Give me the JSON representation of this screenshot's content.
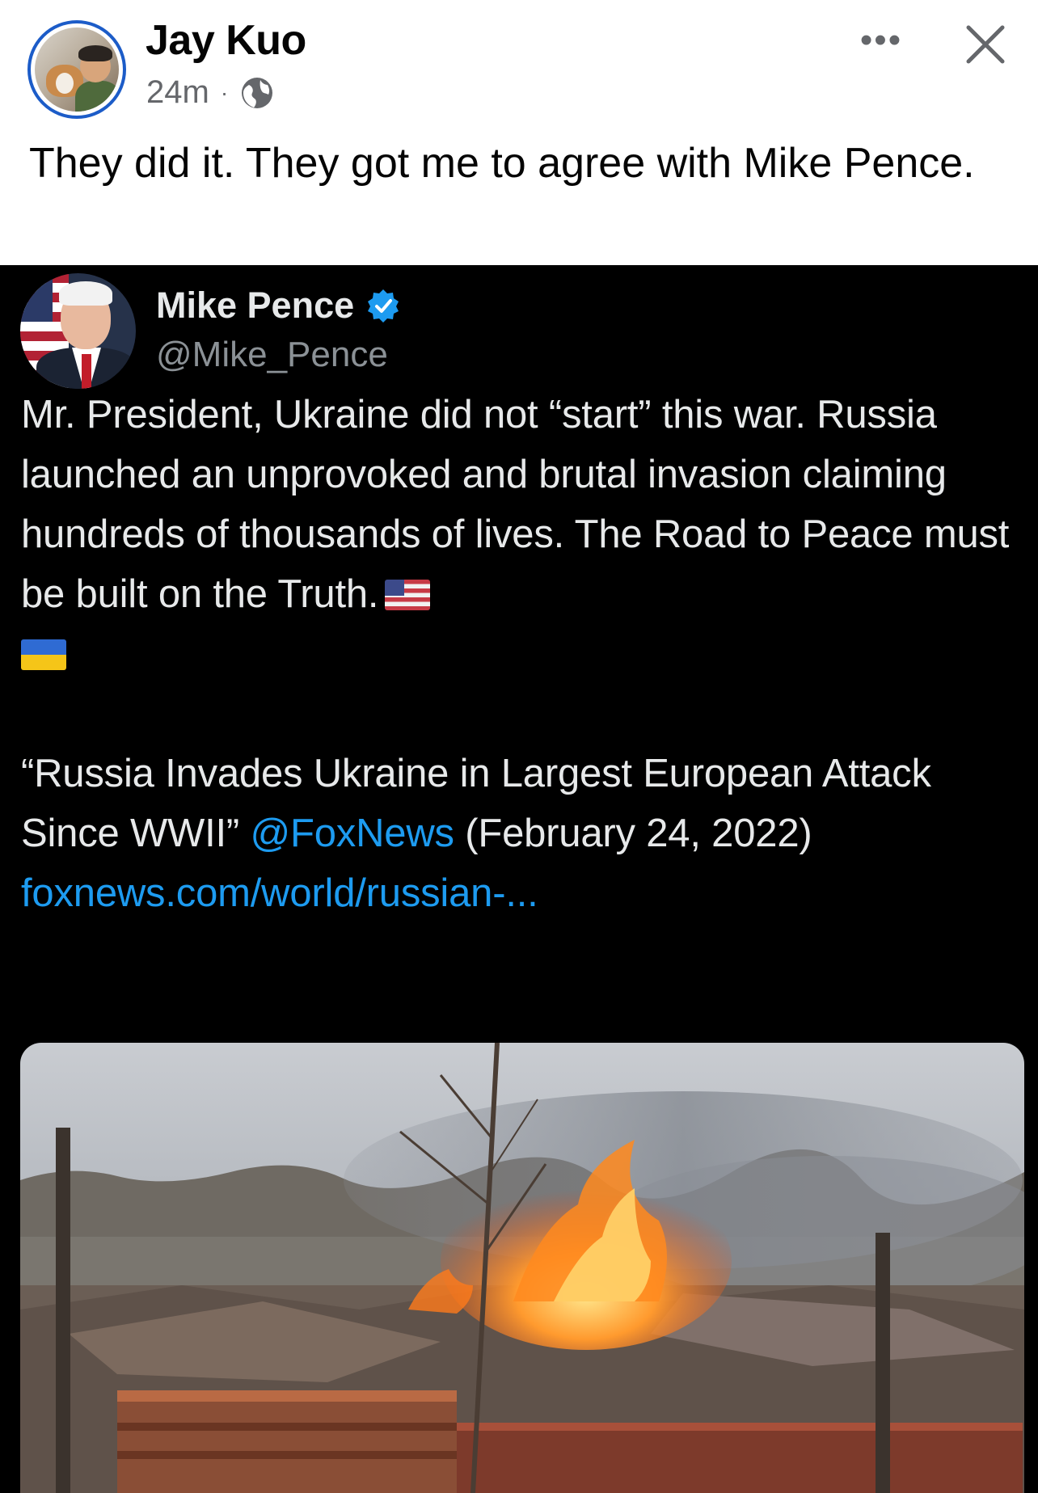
{
  "post": {
    "author": "Jay Kuo",
    "time": "24m",
    "separator": "·",
    "audience_icon": "globe-icon",
    "more_label": "•••",
    "text": "They did it. They got me to agree with Mike Pence."
  },
  "tweet": {
    "name": "Mike Pence",
    "handle": "@Mike_Pence",
    "verified_icon": "verified-badge-icon",
    "line1": "Mr. President, Ukraine did not “start” this war. Russia launched an unprovoked and brutal invasion claiming hundreds of thousands of lives. The Road to Peace must be built on the Truth.",
    "headline": "“Russia Invades Ukraine in Largest European Attack Since WWII”",
    "mention": "@FoxNews",
    "date": "(February 24, 2022)",
    "url": "foxnews.com/world/russian-...",
    "media_description": "burning-building-photo"
  },
  "colors": {
    "fb_avatar_ring": "#1c5cc8",
    "fb_text": "#050505",
    "fb_meta": "#65676b",
    "tweet_bg": "#000000",
    "tweet_text": "#e7e9ea",
    "tweet_link": "#1d9bf0",
    "verified": "#1d9bf0"
  }
}
